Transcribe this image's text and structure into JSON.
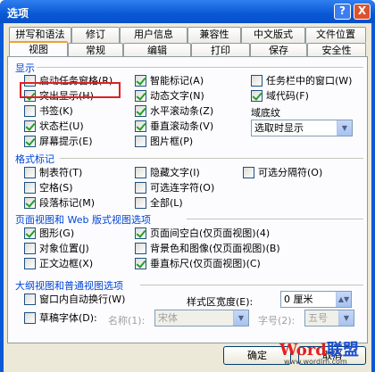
{
  "window": {
    "title": "选项",
    "help": "?",
    "close": "X"
  },
  "tabs_row1": [
    "拼写和语法",
    "修订",
    "用户信息",
    "兼容性",
    "中文版式",
    "文件位置"
  ],
  "tabs_row2": [
    "视图",
    "常规",
    "编辑",
    "打印",
    "保存",
    "安全性"
  ],
  "display": {
    "header": "显示",
    "col1": [
      {
        "label": "启动任务窗格(R)",
        "checked": false
      },
      {
        "label": "突出显示(H)",
        "checked": true
      },
      {
        "label": "书签(K)",
        "checked": false
      },
      {
        "label": "状态栏(U)",
        "checked": true
      },
      {
        "label": "屏幕提示(E)",
        "checked": true
      }
    ],
    "col2": [
      {
        "label": "智能标记(A)",
        "checked": true
      },
      {
        "label": "动态文字(N)",
        "checked": true
      },
      {
        "label": "水平滚动条(Z)",
        "checked": true
      },
      {
        "label": "垂直滚动条(V)",
        "checked": true
      },
      {
        "label": "图片框(P)",
        "checked": false
      }
    ],
    "col3": [
      {
        "label": "任务栏中的窗口(W)",
        "checked": false
      },
      {
        "label": "域代码(F)",
        "checked": true
      }
    ],
    "field_shading_label": "域底纹",
    "field_shading_value": "选取时显示"
  },
  "format": {
    "header": "格式标记",
    "col1": [
      {
        "label": "制表符(T)",
        "checked": false
      },
      {
        "label": "空格(S)",
        "checked": false
      },
      {
        "label": "段落标记(M)",
        "checked": true
      }
    ],
    "col2": [
      {
        "label": "隐藏文字(I)",
        "checked": false
      },
      {
        "label": "可选连字符(O)",
        "checked": false
      },
      {
        "label": "全部(L)",
        "checked": false
      }
    ],
    "col3": [
      {
        "label": "可选分隔符(O)",
        "checked": false
      }
    ]
  },
  "page_view": {
    "header": "页面视图和 Web 版式视图选项",
    "col1": [
      {
        "label": "图形(G)",
        "checked": true
      },
      {
        "label": "对象位置(J)",
        "checked": false
      },
      {
        "label": "正文边框(X)",
        "checked": false
      }
    ],
    "col2": [
      {
        "label": "页面间空白(仅页面视图)(4)",
        "checked": true
      },
      {
        "label": "背景色和图像(仅页面视图)(B)",
        "checked": false
      },
      {
        "label": "垂直标尺(仅页面视图)(C)",
        "checked": true
      }
    ]
  },
  "outline": {
    "header": "大纲视图和普通视图选项",
    "wrap": {
      "label": "窗口内自动换行(W)",
      "checked": false
    },
    "draft": {
      "label": "草稿字体(D):",
      "checked": false
    },
    "name_label": "名称(1):",
    "name_value": "宋体",
    "style_width_label": "样式区宽度(E):",
    "style_width_value": "0 厘米",
    "size_label": "字号(2):",
    "size_value": "五号"
  },
  "buttons": {
    "ok": "确定",
    "cancel": "取消"
  },
  "watermark": {
    "brand_a": "Word",
    "brand_b": "联盟",
    "url": "www.wordlm.com"
  }
}
